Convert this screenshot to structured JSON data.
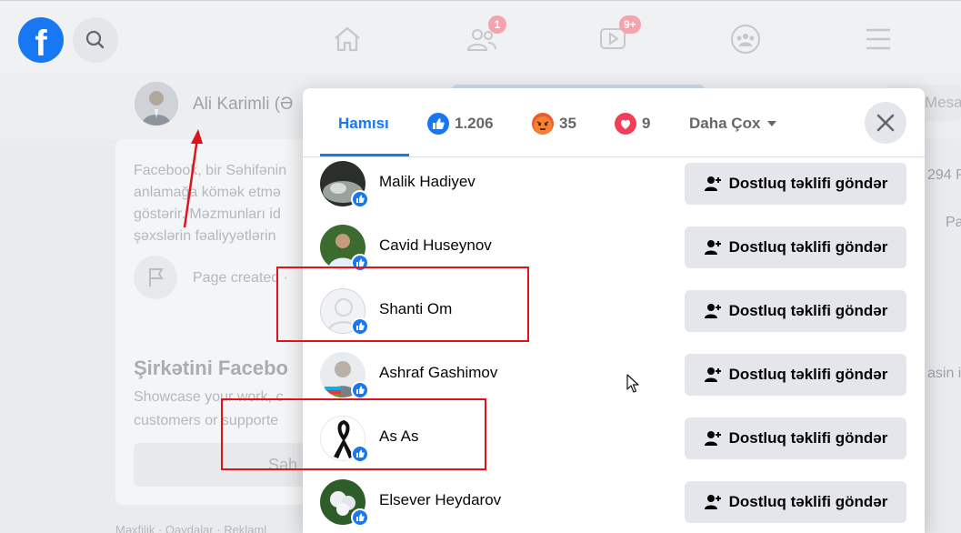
{
  "topbar": {
    "logo_letter": "f",
    "notification_badges": {
      "friends": "1",
      "watch": "9+"
    }
  },
  "background": {
    "profile_name": "Ali Karimli (Ə",
    "intro_lines": [
      "Facebook, bir Səhifənin",
      "anlamağa kömək etmə",
      "göstərir. Məzmunları id",
      "şəxslərin fəaliyyətlərin"
    ],
    "page_created": "Page created ·",
    "promo_title": "Şirkətini Facebo",
    "promo_lines": [
      "Showcase your work, c",
      "customers or supporte"
    ],
    "promo_button": "Səh",
    "footer": "Məxfilik · Qaydalar · Reklaml",
    "right_fragments": {
      "message": "Mesa",
      "count": "294 P",
      "pa": "Pa",
      "asin": "asin i"
    }
  },
  "modal": {
    "tabs": [
      {
        "label": "Hamısı",
        "active": true
      },
      {
        "label": "1.206",
        "icon": "like-reaction-icon",
        "color": "#1877f2"
      },
      {
        "label": "35",
        "icon": "angry-reaction-icon",
        "color": "#f05a28"
      },
      {
        "label": "9",
        "icon": "love-reaction-icon",
        "color": "#f33e58"
      },
      {
        "label": "Daha Çox",
        "icon": "caret-down-icon"
      }
    ],
    "add_friend_label": "Dostluq təklifi göndər",
    "people": [
      {
        "name": "Malik Hadiyev"
      },
      {
        "name": "Cavid Huseynov"
      },
      {
        "name": "Shanti Om"
      },
      {
        "name": "Ashraf Gashimov"
      },
      {
        "name": "As As"
      },
      {
        "name": "Elsever Heydarov"
      }
    ]
  },
  "colors": {
    "accent": "#1877f2",
    "annotation_red": "#e0131c"
  }
}
